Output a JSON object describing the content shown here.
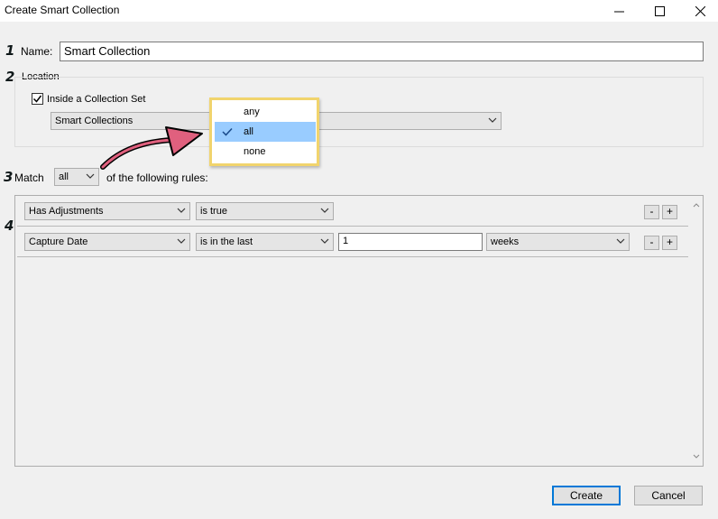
{
  "window": {
    "title": "Create Smart Collection",
    "controls": {
      "minimize": "minimize-icon",
      "maximize": "maximize-icon",
      "close": "close-icon"
    }
  },
  "annotations": {
    "step1": "1",
    "step2": "2",
    "step3": "3",
    "step4": "4",
    "arrow_color": "#e0607e"
  },
  "name_field": {
    "label": "Name:",
    "value": "Smart Collection"
  },
  "location": {
    "group_label": "Location",
    "inside_set_label": "Inside a Collection Set",
    "inside_set_checked": true,
    "collection_set_value": "Smart Collections"
  },
  "match": {
    "label": "Match",
    "value": "all",
    "suffix": "of the following rules:",
    "options": [
      {
        "label": "any",
        "selected": false
      },
      {
        "label": "all",
        "selected": true
      },
      {
        "label": "none",
        "selected": false
      }
    ]
  },
  "rules": [
    {
      "field": "Has Adjustments",
      "operator": "is true",
      "remove_label": "-",
      "add_label": "+"
    },
    {
      "field": "Capture Date",
      "operator": "is in the last",
      "value": "1",
      "unit": "weeks",
      "remove_label": "-",
      "add_label": "+"
    }
  ],
  "buttons": {
    "create": "Create",
    "cancel": "Cancel"
  },
  "colors": {
    "accent": "#0078d7",
    "selection": "#99ccff",
    "popup_border": "#f1d46d"
  }
}
